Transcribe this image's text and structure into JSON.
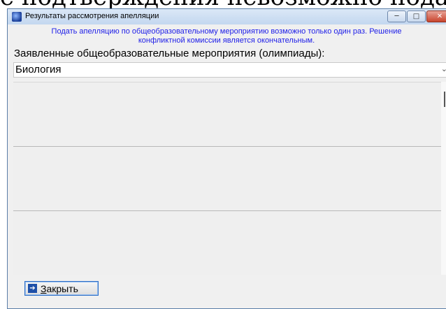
{
  "background": {
    "overlapping_text": "е подтверждения невозможно подать апелляцию, если их заявление о проведении апелляции"
  },
  "window": {
    "title": "Результаты рассмотрения апелляции",
    "controls": {
      "minimize_icon": "minimize-icon",
      "maximize_icon": "maximize-icon",
      "close_icon": "close-icon"
    }
  },
  "notice": {
    "line1": "Подать апелляцию по общеобразовательному мероприятию возможно только один раз. Решение",
    "line2": "конфликтной комиссии является окончательным.",
    "color": "#2020e8"
  },
  "events": {
    "label": "Заявленные общеобразовательные мероприятия (олимпиады):",
    "selected": "Биология"
  },
  "footer": {
    "close_button": {
      "label_first_letter": "З",
      "label_rest": "акрыть",
      "icon": "exit-arrow-icon"
    }
  }
}
